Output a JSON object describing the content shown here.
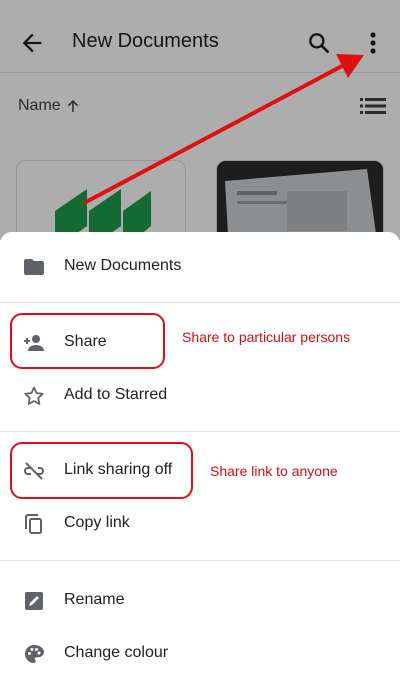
{
  "appbar": {
    "title": "New Documents",
    "back_icon": "arrow-back-icon",
    "search_icon": "search-icon",
    "more_icon": "more-vert-icon"
  },
  "sort": {
    "label": "Name",
    "direction_icon": "arrow-up-icon",
    "view_icon": "list-view-icon"
  },
  "sheet": {
    "header": {
      "icon": "folder-icon",
      "label": "New Documents"
    },
    "items": [
      {
        "icon": "person-add-icon",
        "label": "Share"
      },
      {
        "icon": "star-outline-icon",
        "label": "Add to Starred"
      },
      {
        "icon": "link-off-icon",
        "label": "Link sharing off"
      },
      {
        "icon": "copy-icon",
        "label": "Copy link"
      },
      {
        "icon": "rename-icon",
        "label": "Rename"
      },
      {
        "icon": "palette-icon",
        "label": "Change colour"
      }
    ]
  },
  "annotations": {
    "share_note": "Share to particular persons",
    "link_note": "Share link to anyone",
    "color": "#e01010"
  },
  "colors": {
    "text": "#202124",
    "icon": "#5f6368",
    "logo_green": "#1e9e4a",
    "annotation": "#d01010"
  }
}
